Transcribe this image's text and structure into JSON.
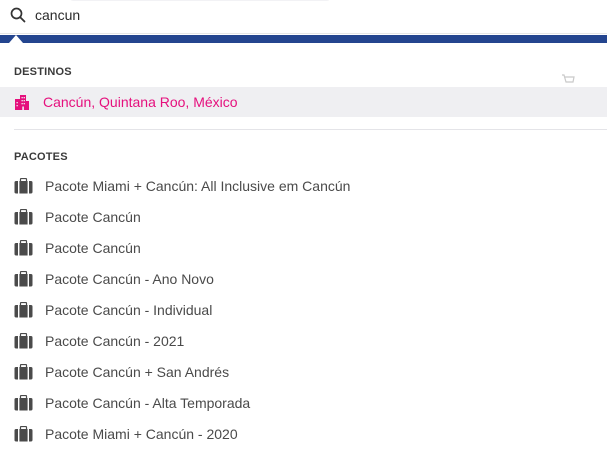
{
  "search": {
    "value": "cancun",
    "icon": "search-icon"
  },
  "colors": {
    "header_blue": "#24458f",
    "accent_pink": "#e5107d",
    "highlight_bg": "#efeff2",
    "text": "#4a4a4a"
  },
  "destinations": {
    "title": "DESTINOS",
    "items": [
      {
        "label": "Cancún, Quintana Roo, México",
        "icon": "city-icon"
      }
    ]
  },
  "packages": {
    "title": "PACOTES",
    "icon": "suitcase-icon",
    "items": [
      {
        "label": "Pacote Miami + Cancún: All Inclusive em Cancún"
      },
      {
        "label": "Pacote Cancún"
      },
      {
        "label": "Pacote Cancún"
      },
      {
        "label": "Pacote Cancún - Ano Novo"
      },
      {
        "label": "Pacote Cancún - Individual"
      },
      {
        "label": "Pacote Cancún - 2021"
      },
      {
        "label": "Pacote Cancún + San Andrés"
      },
      {
        "label": "Pacote Cancún - Alta Temporada"
      },
      {
        "label": "Pacote Miami + Cancún - 2020"
      }
    ]
  }
}
